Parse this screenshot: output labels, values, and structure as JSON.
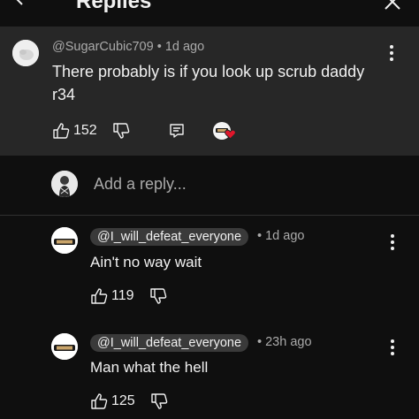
{
  "header": {
    "title": "Replies"
  },
  "top_comment": {
    "handle": "@SugarCubic709",
    "time": " • 1d ago",
    "text": "There probably is if you look up scrub daddy r34",
    "likes": "152"
  },
  "reply_bar": {
    "placeholder": "Add a reply..."
  },
  "replies": [
    {
      "handle": "@I_will_defeat_everyone",
      "time": "• 1d ago",
      "text": "Ain't no way wait",
      "likes": "119"
    },
    {
      "handle": "@I_will_defeat_everyone",
      "time": "• 23h ago",
      "text": "Man what the hell",
      "likes": "125"
    }
  ],
  "colors": {
    "heart": "#e0162b",
    "top_comment_bg": "#272727",
    "page_bg": "#0f0f0f"
  }
}
